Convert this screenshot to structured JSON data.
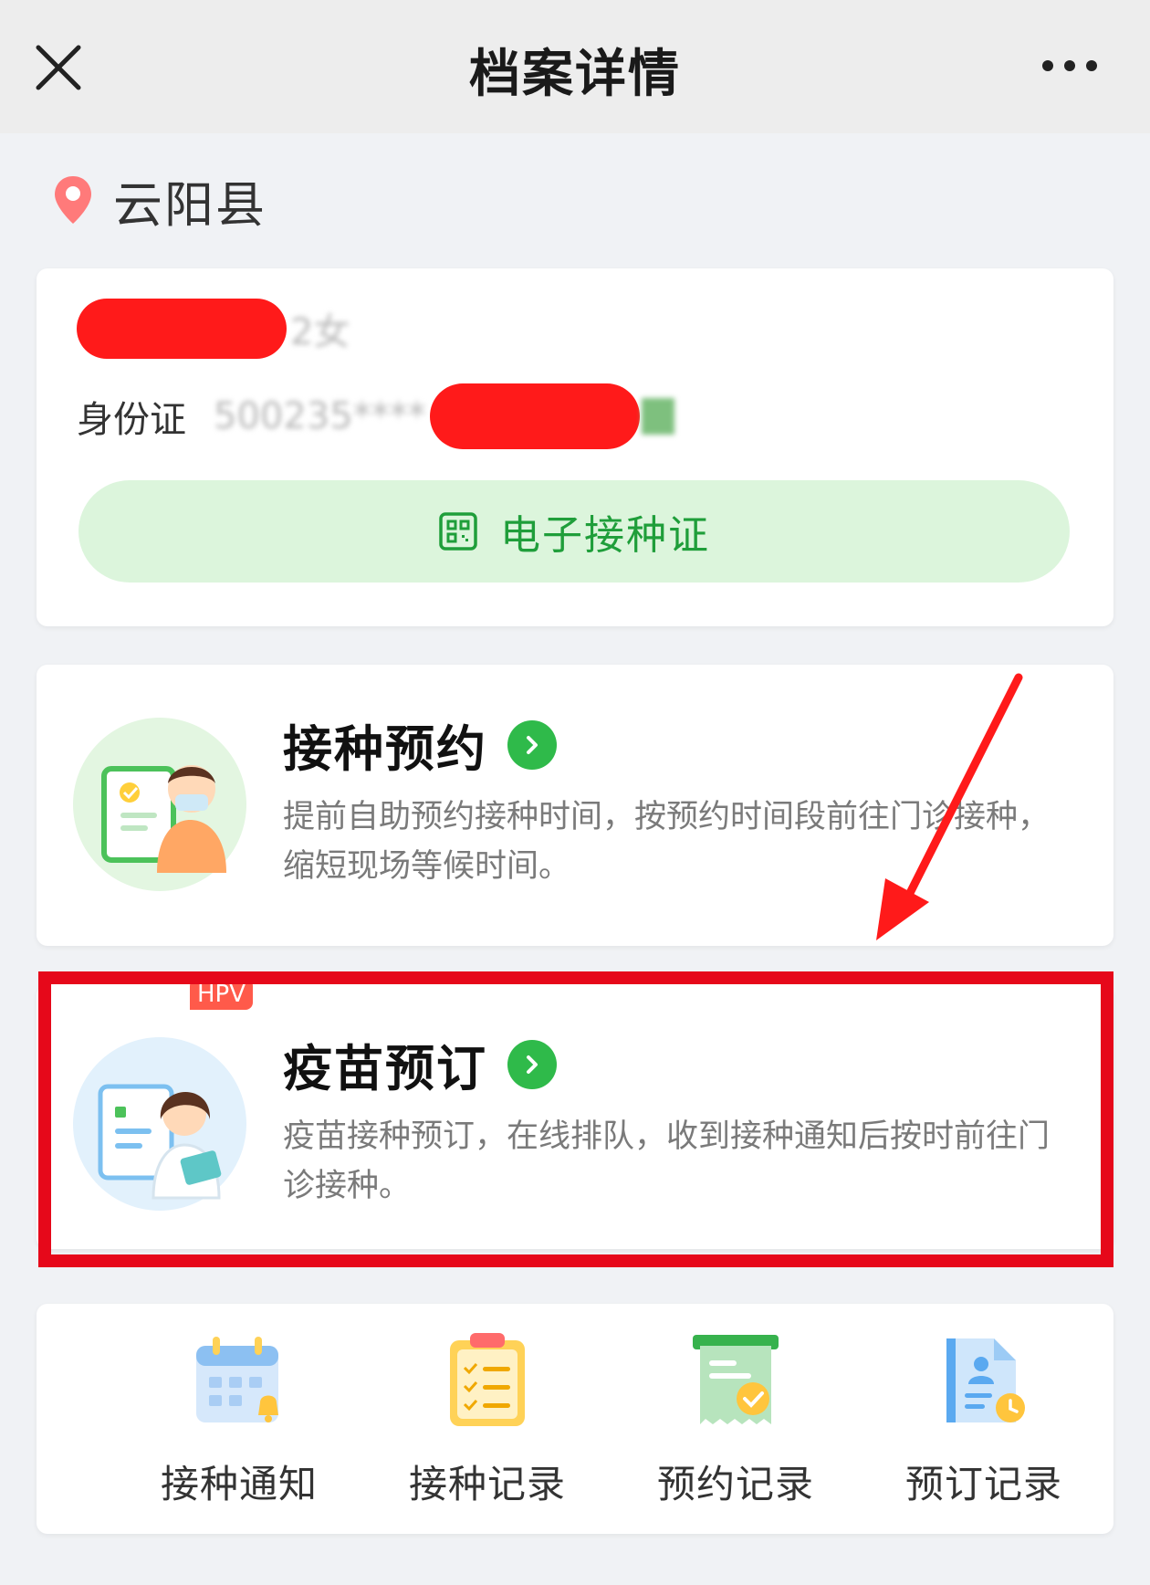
{
  "header": {
    "title": "档案详情"
  },
  "location": {
    "name": "云阳县"
  },
  "profile": {
    "name_suffix": "2女",
    "id_prefix": "身份证",
    "id_number": "500235****"
  },
  "ecard": {
    "label": "电子接种证"
  },
  "services": [
    {
      "title": "接种预约",
      "desc": "提前自助预约接种时间，按预约时间段前往门诊接种，缩短现场等候时间。"
    },
    {
      "title": "疫苗预订",
      "badge": "HPV",
      "desc": "疫苗接种预订，在线排队，收到接种通知后按时前往门诊接种。"
    }
  ],
  "quick_links": [
    {
      "label": "接种通知",
      "icon": "calendar-bell-icon"
    },
    {
      "label": "接种记录",
      "icon": "clipboard-checklist-icon"
    },
    {
      "label": "预约记录",
      "icon": "receipt-check-icon"
    },
    {
      "label": "预订记录",
      "icon": "document-person-clock-icon"
    }
  ],
  "colors": {
    "accent_green": "#2fba4a",
    "annotation_red": "#e6081a",
    "pin": "#ff7a7a"
  }
}
